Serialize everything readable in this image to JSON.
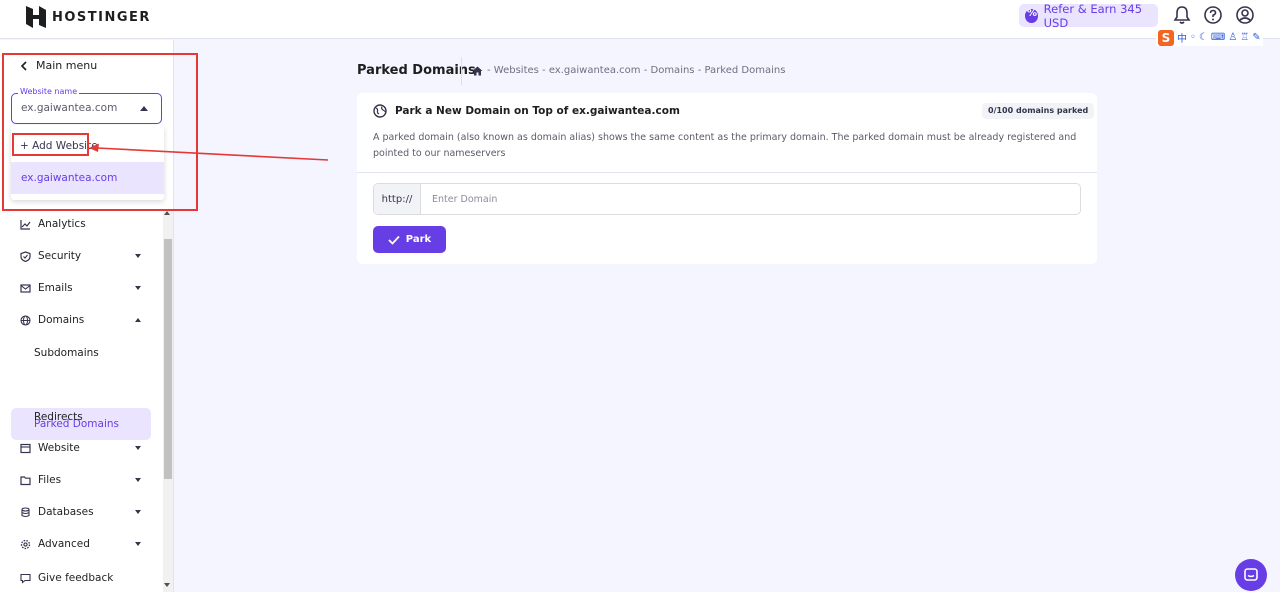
{
  "header": {
    "brand": "HOSTINGER",
    "refer_label": "Refer & Earn 345 USD",
    "ime_char": "中",
    "ime_logo": "S"
  },
  "sidebar": {
    "main_menu_label": "Main menu",
    "website_select": {
      "label": "Website name",
      "value": "ex.gaiwantea.com"
    },
    "dropdown": {
      "add_label": "+ Add Website",
      "items": [
        "ex.gaiwantea.com"
      ]
    },
    "nav": [
      {
        "label": "Analytics",
        "icon": "chart-line-icon"
      },
      {
        "label": "Security",
        "icon": "shield-icon"
      },
      {
        "label": "Emails",
        "icon": "envelope-icon"
      },
      {
        "label": "Domains",
        "icon": "globe-icon"
      },
      {
        "label": "Website",
        "icon": "browser-icon"
      },
      {
        "label": "Files",
        "icon": "folder-icon"
      },
      {
        "label": "Databases",
        "icon": "database-icon"
      },
      {
        "label": "Advanced",
        "icon": "gear-icon"
      }
    ],
    "domain_sub": [
      "Subdomains",
      "Parked Domains",
      "Redirects"
    ],
    "feedback_label": "Give feedback"
  },
  "main": {
    "title": "Parked Domains",
    "breadcrumb": "- Websites - ex.gaiwantea.com - Domains - Parked Domains",
    "card": {
      "heading": "Park a New Domain on Top of ex.gaiwantea.com",
      "badge": "0/100 domains parked",
      "description": "A parked domain (also known as domain alias) shows the same content as the primary domain. The parked domain must be already registered and pointed to our nameservers",
      "prefix": "http://",
      "input_placeholder": "Enter Domain",
      "park_label": "Park"
    }
  },
  "colors": {
    "accent": "#673de6",
    "accent_light": "#ebe4ff",
    "annotation": "#e53935"
  }
}
